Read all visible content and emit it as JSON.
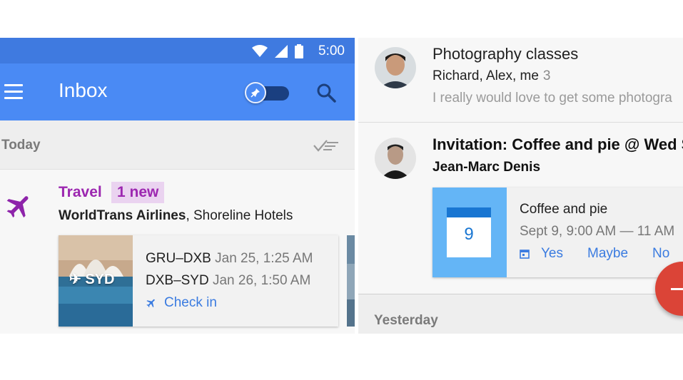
{
  "left_screen": {
    "status_bar": {
      "time": "5:00",
      "icons": [
        "wifi-icon",
        "cell-signal-icon",
        "battery-icon"
      ]
    },
    "app_bar": {
      "title": "Inbox",
      "pin_toggle_icon": "pin-icon",
      "search_icon": "search-icon",
      "menu_icon": "menu-icon"
    },
    "section_today": {
      "label": "Today",
      "sweep_icon": "sweep-done-icon"
    },
    "travel_bundle": {
      "icon": "airplane-icon",
      "title": "Travel",
      "badge": "1 new",
      "sender_bold": "WorldTrans Airlines",
      "sender_rest": ", Shoreline Hotels",
      "trip": {
        "destination": "SYD",
        "flights": [
          {
            "route": "GRU–DXB",
            "datetime": "Jan 25, 1:25 AM"
          },
          {
            "route": "DXB–SYD",
            "datetime": "Jan 26, 1:50 AM"
          }
        ],
        "action": "Check in"
      }
    }
  },
  "right_screen": {
    "thread_1": {
      "subject": "Photography classes",
      "participants": "Richard, Alex, me",
      "count": "3",
      "snippet": "I really would love to get some photogra"
    },
    "thread_2": {
      "subject": "Invitation: Coffee and pie @ Wed S",
      "sender": "Jean-Marc Denis",
      "event": {
        "calendar_day": "9",
        "title": "Coffee and pie",
        "time": "Sept 9, 9:00 AM — 11 AM",
        "rsvp": {
          "yes": "Yes",
          "maybe": "Maybe",
          "no": "No"
        }
      }
    },
    "section_yesterday": {
      "label": "Yesterday"
    },
    "fab_icon": "plus-icon"
  },
  "colors": {
    "app_bar": "#4a8af4",
    "status_bar": "#3f7ae0",
    "travel_purple": "#9c27b0",
    "link_blue": "#3a7be0",
    "fab_red": "#db4437",
    "calendar_blue": "#64b5f6"
  }
}
